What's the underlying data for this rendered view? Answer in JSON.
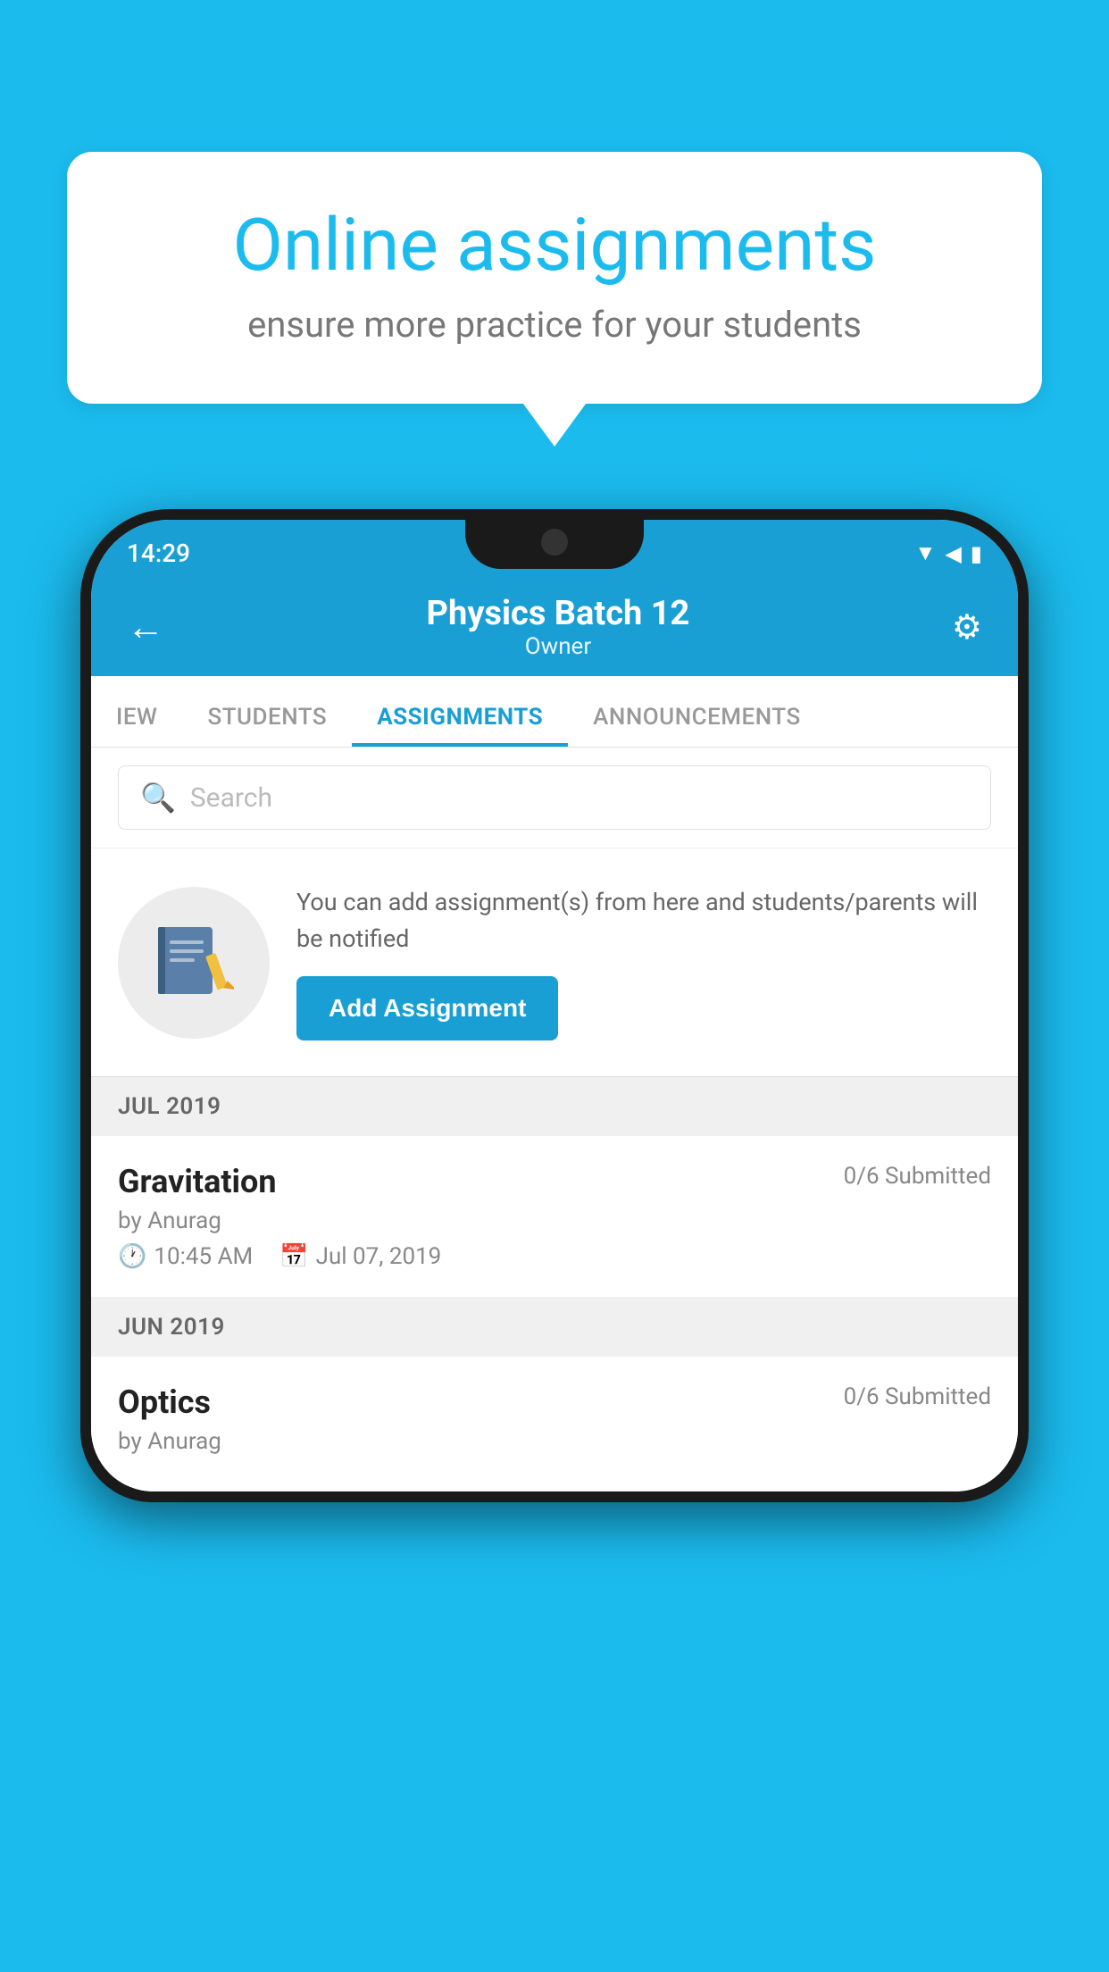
{
  "background_color": "#1BBBEE",
  "speech_bubble": {
    "title": "Online assignments",
    "subtitle": "ensure more practice for your students"
  },
  "status_bar": {
    "time": "14:29",
    "icons": [
      "wifi",
      "signal",
      "battery"
    ]
  },
  "header": {
    "title": "Physics Batch 12",
    "subtitle": "Owner",
    "back_label": "←",
    "settings_label": "⚙"
  },
  "tabs": [
    {
      "label": "IEW",
      "active": false
    },
    {
      "label": "STUDENTS",
      "active": false
    },
    {
      "label": "ASSIGNMENTS",
      "active": true
    },
    {
      "label": "ANNOUNCEMENTS",
      "active": false
    }
  ],
  "search": {
    "placeholder": "Search"
  },
  "add_assignment_section": {
    "description": "You can add assignment(s) from here and students/parents will be notified",
    "button_label": "Add Assignment"
  },
  "sections": [
    {
      "month": "JUL 2019",
      "assignments": [
        {
          "title": "Gravitation",
          "submitted": "0/6 Submitted",
          "author": "by Anurag",
          "time": "10:45 AM",
          "date": "Jul 07, 2019"
        }
      ]
    },
    {
      "month": "JUN 2019",
      "assignments": [
        {
          "title": "Optics",
          "submitted": "0/6 Submitted",
          "author": "by Anurag",
          "time": "",
          "date": ""
        }
      ]
    }
  ]
}
